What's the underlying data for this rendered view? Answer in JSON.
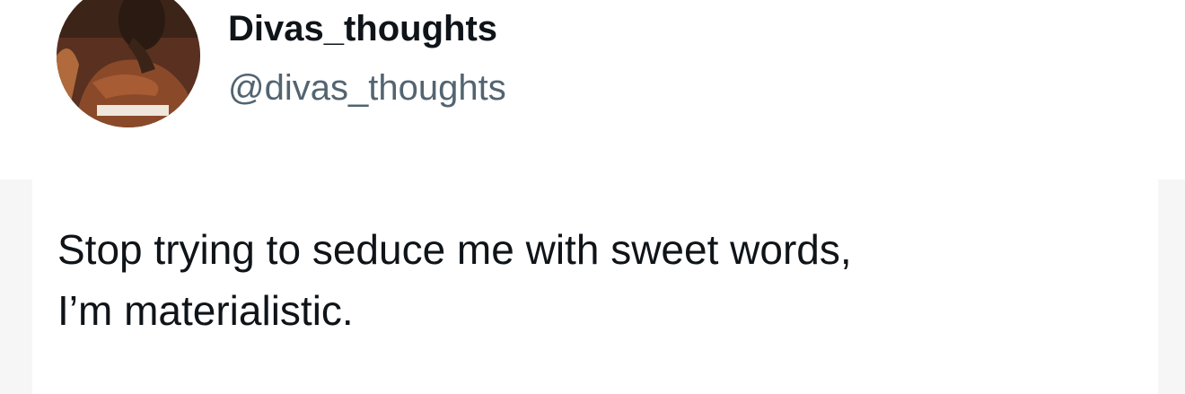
{
  "author": {
    "display_name": "Divas_thoughts",
    "handle": "@divas_thoughts"
  },
  "tweet": {
    "lines": [
      "Stop trying to seduce me with sweet words,",
      "I’m materialistic."
    ]
  },
  "colors": {
    "text_primary": "#0f1419",
    "text_secondary": "#536471",
    "background": "#ffffff"
  }
}
